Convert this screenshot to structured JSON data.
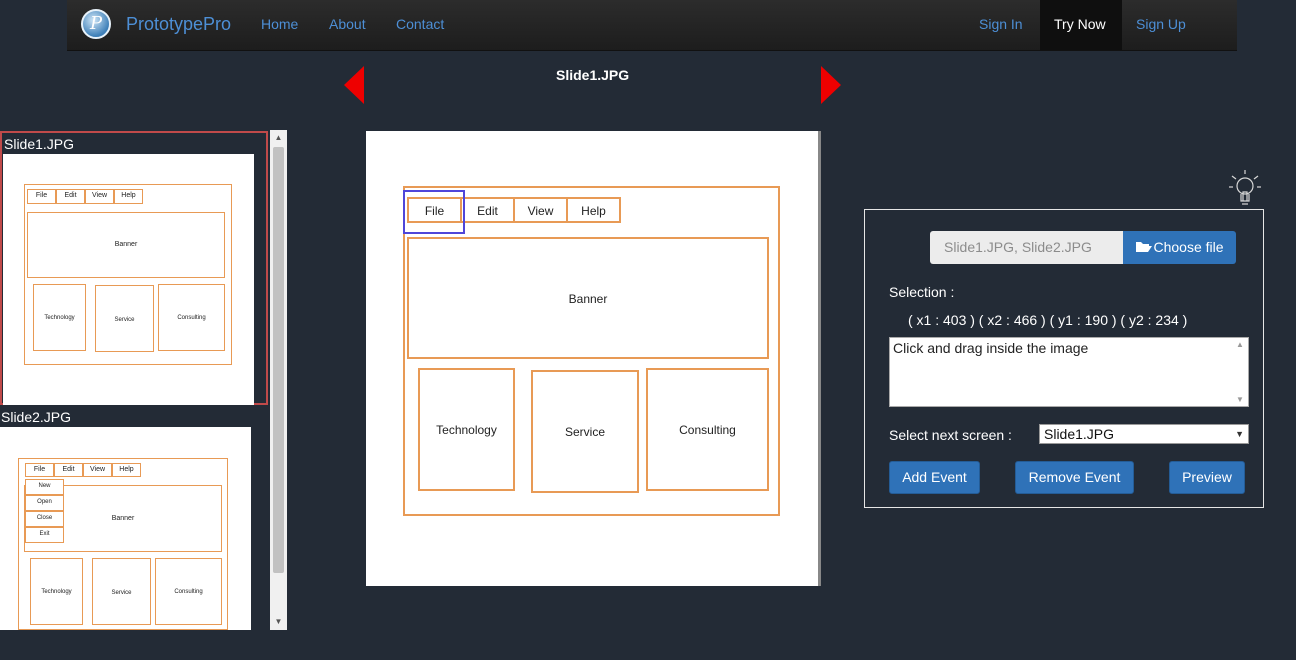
{
  "nav": {
    "brand_logo_letter": "P",
    "brand": "PrototypePro",
    "links": [
      "Home",
      "About",
      "Contact"
    ],
    "right_links": [
      "Sign In",
      "Try Now",
      "Sign Up"
    ]
  },
  "viewer": {
    "current_slide": "Slide1.JPG",
    "prev_icon": "triangle-left-icon",
    "next_icon": "triangle-right-icon"
  },
  "thumbnails": [
    {
      "label": "Slide1.JPG",
      "selected": true
    },
    {
      "label": "Slide2.JPG",
      "selected": false
    }
  ],
  "slide_content": {
    "menu": [
      "File",
      "Edit",
      "View",
      "Help"
    ],
    "banner": "Banner",
    "boxes": [
      "Technology",
      "Service",
      "Consulting"
    ],
    "file_menu_items": [
      "New",
      "Open",
      "Close",
      "Exit"
    ]
  },
  "panel": {
    "hint_icon": "lightbulb-icon",
    "file_value": "Slide1.JPG, Slide2.JPG",
    "choose_file_label": "Choose file",
    "choose_file_icon": "folder-open-icon",
    "selection_label": "Selection :",
    "selection_coords": "( x1 : 403 ) ( x2 : 466 ) ( y1 : 190 ) ( y2 : 234 )",
    "instructions": "Click and drag inside the image",
    "next_screen_label": "Select next screen :",
    "next_screen_value": "Slide1.JPG",
    "add_event": "Add Event",
    "remove_event": "Remove Event",
    "preview": "Preview"
  },
  "colors": {
    "background": "#232b36",
    "accent": "#2f72b8",
    "link": "#4d8fd6",
    "wireframe_stroke": "#e89a55",
    "selection_stroke": "#4f46d9",
    "arrow": "#ee0000",
    "thumb_selected_border": "#c04a4a"
  }
}
